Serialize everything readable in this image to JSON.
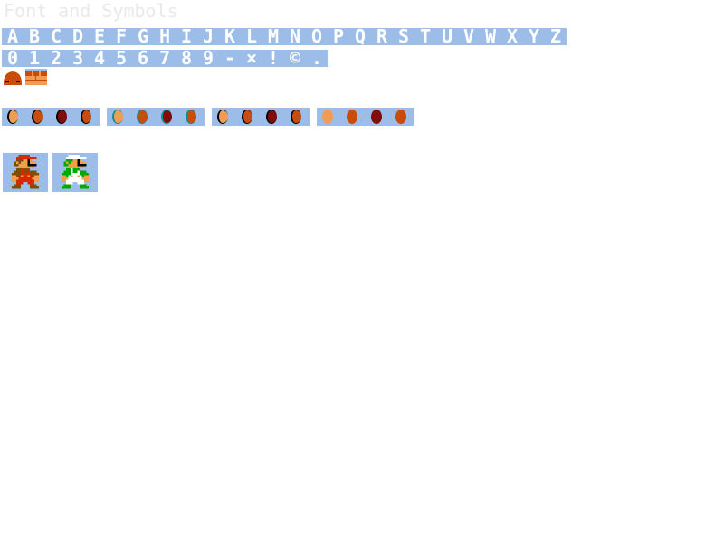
{
  "sheet": {
    "title": "Font and Symbols",
    "background": "#ffffff",
    "cell_background": "#9cbde8"
  },
  "font": {
    "letters": [
      "A",
      "B",
      "C",
      "D",
      "E",
      "F",
      "G",
      "H",
      "I",
      "J",
      "K",
      "L",
      "M",
      "N",
      "O",
      "P",
      "Q",
      "R",
      "S",
      "T",
      "U",
      "V",
      "W",
      "X",
      "Y",
      "Z"
    ],
    "symbols": [
      "0",
      "1",
      "2",
      "3",
      "4",
      "5",
      "6",
      "7",
      "8",
      "9",
      "-",
      "×",
      "!",
      "©",
      "."
    ],
    "color": "#ffffff"
  },
  "tiles": [
    {
      "name": "goomba-icon",
      "color": "#c84c0c"
    },
    {
      "name": "brick-icon",
      "color": "#f09c54"
    }
  ],
  "coins": {
    "groups": [
      {
        "outline": "black",
        "colors": [
          "#f09c54",
          "#c84c0c",
          "#800c0c",
          "#c84c0c"
        ]
      },
      {
        "outline": "teal",
        "colors": [
          "#f09c54",
          "#c84c0c",
          "#800c0c",
          "#c84c0c"
        ]
      },
      {
        "outline": "black",
        "colors": [
          "#f09c54",
          "#c84c0c",
          "#800c0c",
          "#c84c0c"
        ]
      },
      {
        "outline": "none",
        "colors": [
          "#f09c54",
          "#c84c0c",
          "#800c0c",
          "#c84c0c"
        ]
      }
    ]
  },
  "players": [
    {
      "name": "mario-icon",
      "hat": "#d82800",
      "shirt": "#d82800",
      "overalls": "#d82800",
      "skin": "#f0a048",
      "hair": "#7c5000",
      "boots": "#7c5000"
    },
    {
      "name": "luigi-icon",
      "hat": "#ffffff",
      "shirt": "#ffffff",
      "overalls": "#00a800",
      "skin": "#f0a048",
      "hair": "#00a800",
      "boots": "#ffffff"
    }
  ]
}
